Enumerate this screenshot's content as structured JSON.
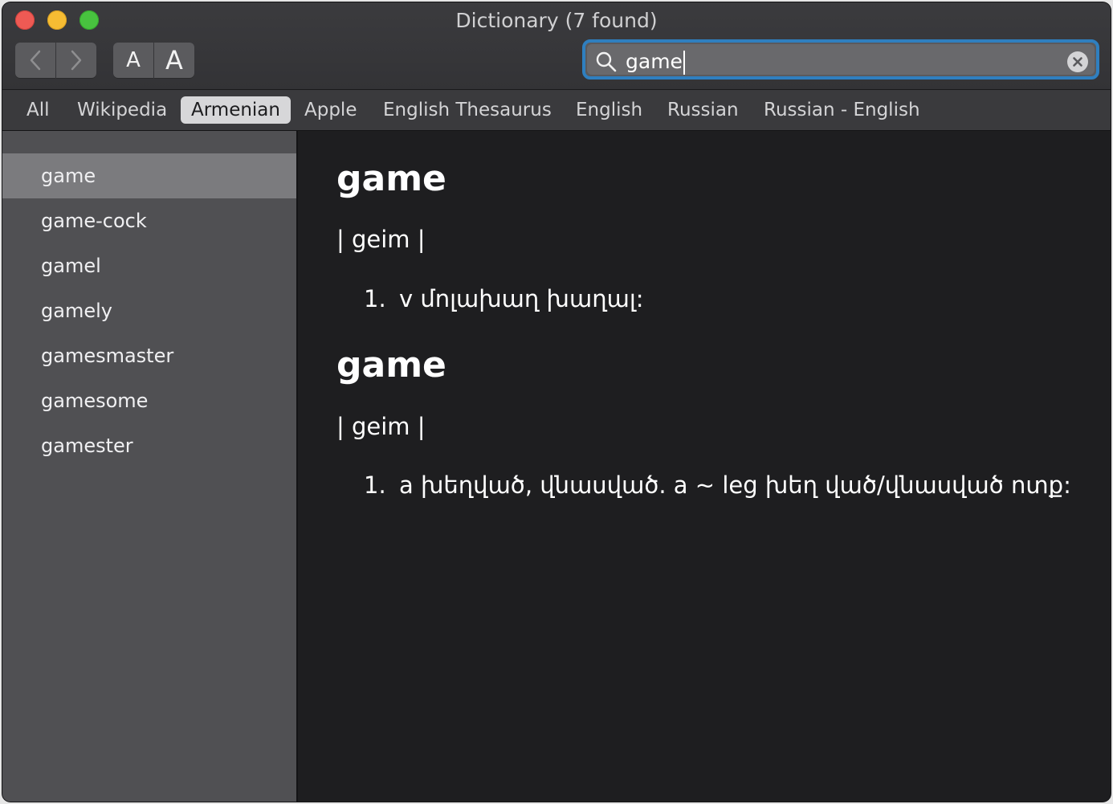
{
  "window": {
    "title": "Dictionary (7 found)"
  },
  "toolbar": {
    "back_icon": "chevron-left-icon",
    "forward_icon": "chevron-right-icon",
    "font_smaller_label": "A",
    "font_larger_label": "A",
    "search_value": "game",
    "search_icon": "magnifier-icon",
    "clear_icon": "clear-circle-icon",
    "focus_color": "#2f7fbf"
  },
  "scopes": {
    "tabs": [
      {
        "label": "All"
      },
      {
        "label": "Wikipedia"
      },
      {
        "label": "Armenian"
      },
      {
        "label": "Apple"
      },
      {
        "label": "English Thesaurus"
      },
      {
        "label": "English"
      },
      {
        "label": "Russian"
      },
      {
        "label": "Russian - English"
      }
    ],
    "active": "Armenian"
  },
  "sidebar": {
    "items": [
      {
        "label": "game"
      },
      {
        "label": "game-cock"
      },
      {
        "label": "gamel"
      },
      {
        "label": "gamely"
      },
      {
        "label": "gamesmaster"
      },
      {
        "label": "gamesome"
      },
      {
        "label": "gamester"
      }
    ],
    "selected": "game"
  },
  "entries": [
    {
      "headword": "game",
      "pronunciation": "| geim |",
      "senses": [
        {
          "num": "1.",
          "text": "v մոլախաղ խաղալ:"
        }
      ]
    },
    {
      "headword": "game",
      "pronunciation": "| geim |",
      "senses": [
        {
          "num": "1.",
          "text": "a խեղված, վնասված. a ~ leg խեղ ված/վնասված ոտք:"
        }
      ]
    }
  ]
}
